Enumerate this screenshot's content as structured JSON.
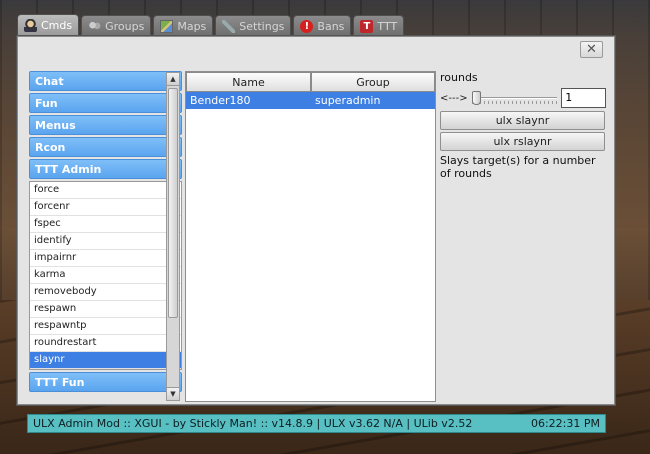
{
  "tabs": [
    {
      "label": "Cmds",
      "icon": "cmds-icon",
      "active": true
    },
    {
      "label": "Groups",
      "icon": "groups-icon",
      "active": false
    },
    {
      "label": "Maps",
      "icon": "maps-icon",
      "active": false
    },
    {
      "label": "Settings",
      "icon": "settings-icon",
      "active": false
    },
    {
      "label": "Bans",
      "icon": "bans-icon",
      "active": false
    },
    {
      "label": "TTT",
      "icon": "ttt-icon",
      "active": false
    }
  ],
  "window": {
    "close_label": "✕"
  },
  "categories": {
    "chat": "Chat",
    "fun": "Fun",
    "menus": "Menus",
    "rcon": "Rcon",
    "ttt_admin": "TTT Admin",
    "ttt_fun": "TTT Fun"
  },
  "ttt_admin_commands": [
    "force",
    "forcenr",
    "fspec",
    "identify",
    "impairnr",
    "karma",
    "removebody",
    "respawn",
    "respawntp",
    "roundrestart",
    "slaynr"
  ],
  "selected_command": "slaynr",
  "players_table": {
    "headers": {
      "name": "Name",
      "group": "Group"
    },
    "rows": [
      {
        "name": "Bender180",
        "group": "superadmin",
        "selected": true
      }
    ]
  },
  "command_panel": {
    "arg_label": "rounds",
    "slider_tag": "<--->",
    "slider_value": "1",
    "buttons": [
      "ulx slaynr",
      "ulx rslaynr"
    ],
    "help": "Slays target(s) for a number of rounds"
  },
  "status": {
    "left": "ULX Admin Mod :: XGUI - by Stickly Man! :: v14.8.9  |  ULX v3.62 N/A  |  ULib v2.52",
    "time": "06:22:31 PM"
  },
  "colors": {
    "accent": "#5aa4ef",
    "selection": "#3d7fe3",
    "statusbar": "#58bfc3"
  }
}
